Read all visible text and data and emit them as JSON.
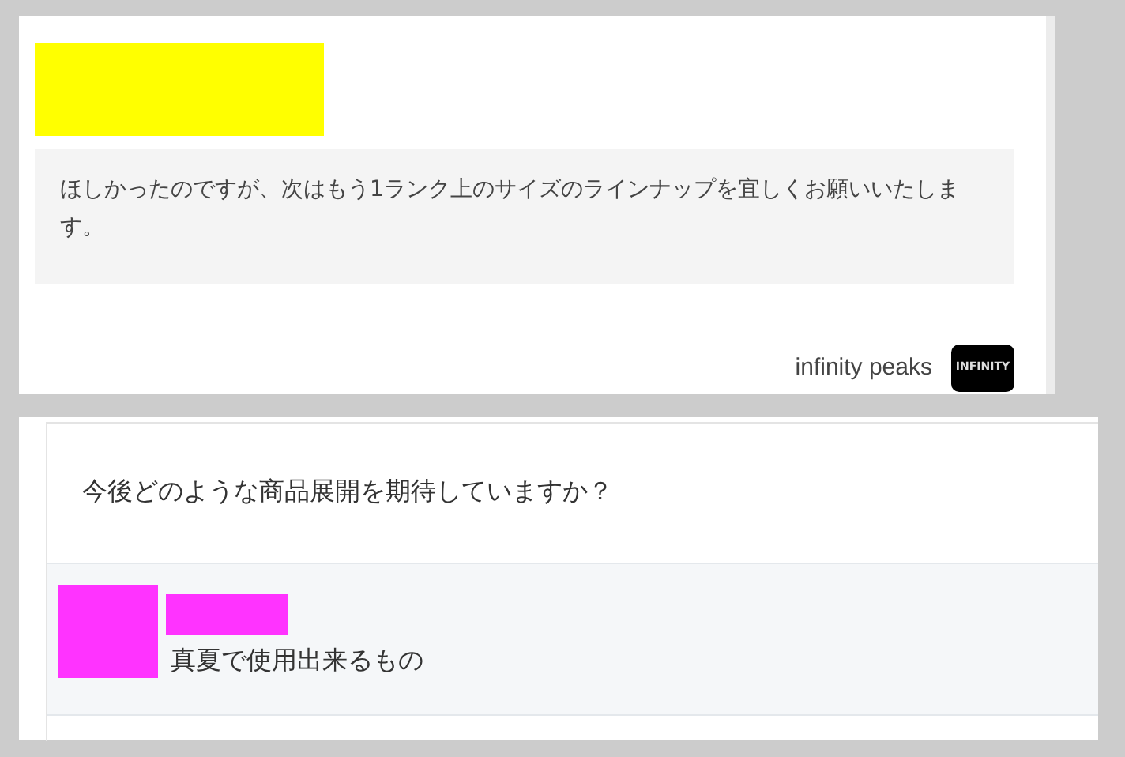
{
  "review": {
    "redaction": {
      "color": "#ffff00"
    },
    "comment": "ほしかったのですが、次はもう1ランク上のサイズのラインナップを宜しくお願いいたします。",
    "shop_name": "infinity peaks",
    "shop_logo": "INFINITY"
  },
  "survey": {
    "question": "今後どのような商品展開を期待していますか？",
    "answer": {
      "avatar": {
        "color": "#ff33ff"
      },
      "name": {
        "color": "#ff33ff"
      },
      "text": "真夏で使用出来るもの"
    }
  }
}
